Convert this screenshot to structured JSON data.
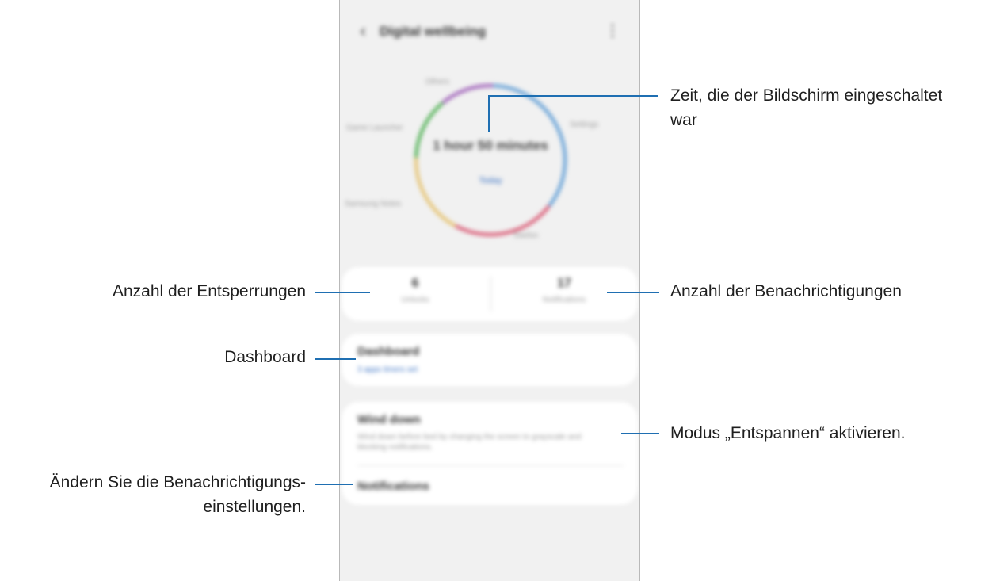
{
  "app": {
    "title": "Digital wellbeing",
    "back_icon": "chevron-left-icon",
    "more_icon": "more-vertical-icon"
  },
  "usage": {
    "total_time": "1 hour 50 minutes",
    "today_label": "Today",
    "categories": [
      {
        "name": "Others",
        "color": "#9b59b6"
      },
      {
        "name": "Settings",
        "color": "#5b9bd5"
      },
      {
        "name": "Telefon",
        "color": "#d9536f"
      },
      {
        "name": "Samsung Notes",
        "color": "#e5c06a"
      },
      {
        "name": "Game Launcher",
        "color": "#4caf50"
      }
    ]
  },
  "stats": {
    "unlocks_count": "6",
    "unlocks_label": "Unlocks",
    "notifications_count": "17",
    "notifications_label": "Notifications"
  },
  "dashboard": {
    "title": "Dashboard",
    "subtitle": "3 apps timers set"
  },
  "wind_down": {
    "title": "Wind down",
    "description": "Wind down before bed by changing the screen to grayscale and blocking notifications."
  },
  "notifications": {
    "title": "Notifications"
  },
  "callouts": {
    "screen_time": "Zeit, die der Bildschirm eingeschaltet",
    "screen_time_line2": "war",
    "unlocks": "Anzahl der Entsperrungen",
    "notifications_count": "Anzahl der Benachrichtigungen",
    "dashboard": "Dashboard",
    "wind_down": "Modus „Entspannen“ aktivieren.",
    "notification_settings": "Ändern Sie die Benachrichtigungs-",
    "notification_settings_line2": "einstellungen."
  },
  "colors": {
    "accent": "#1f6fb2",
    "link": "#3b73c4",
    "background": "#f1f1f1"
  }
}
